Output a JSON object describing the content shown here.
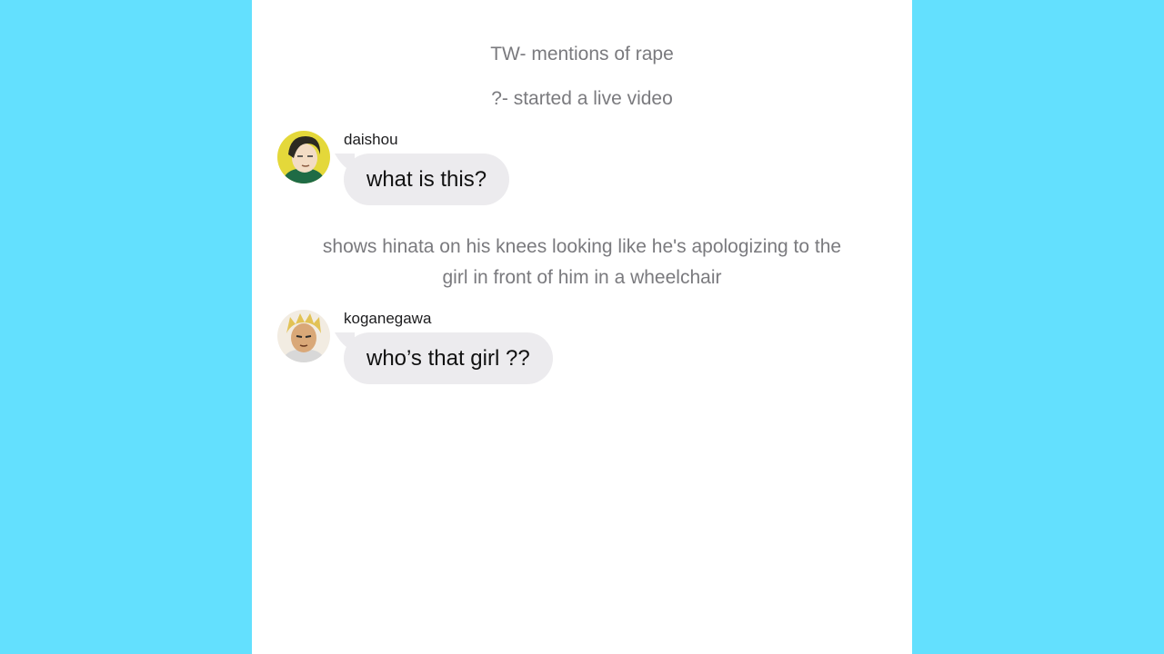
{
  "system_lines": {
    "tw": "TW- mentions of rape",
    "live": "?- started a live video",
    "narration_line1": "shows hinata on his knees looking like he's apologizing to the",
    "narration_line2": "girl in front of him in a wheelchair"
  },
  "messages": [
    {
      "sender": "daishou",
      "text": "what is this?"
    },
    {
      "sender": "koganegawa",
      "text": "who’s that girl ??"
    }
  ],
  "colors": {
    "background": "#63e0fe",
    "screen": "#ffffff",
    "bubble": "#ecebee",
    "system_text": "#7a7a7e"
  }
}
